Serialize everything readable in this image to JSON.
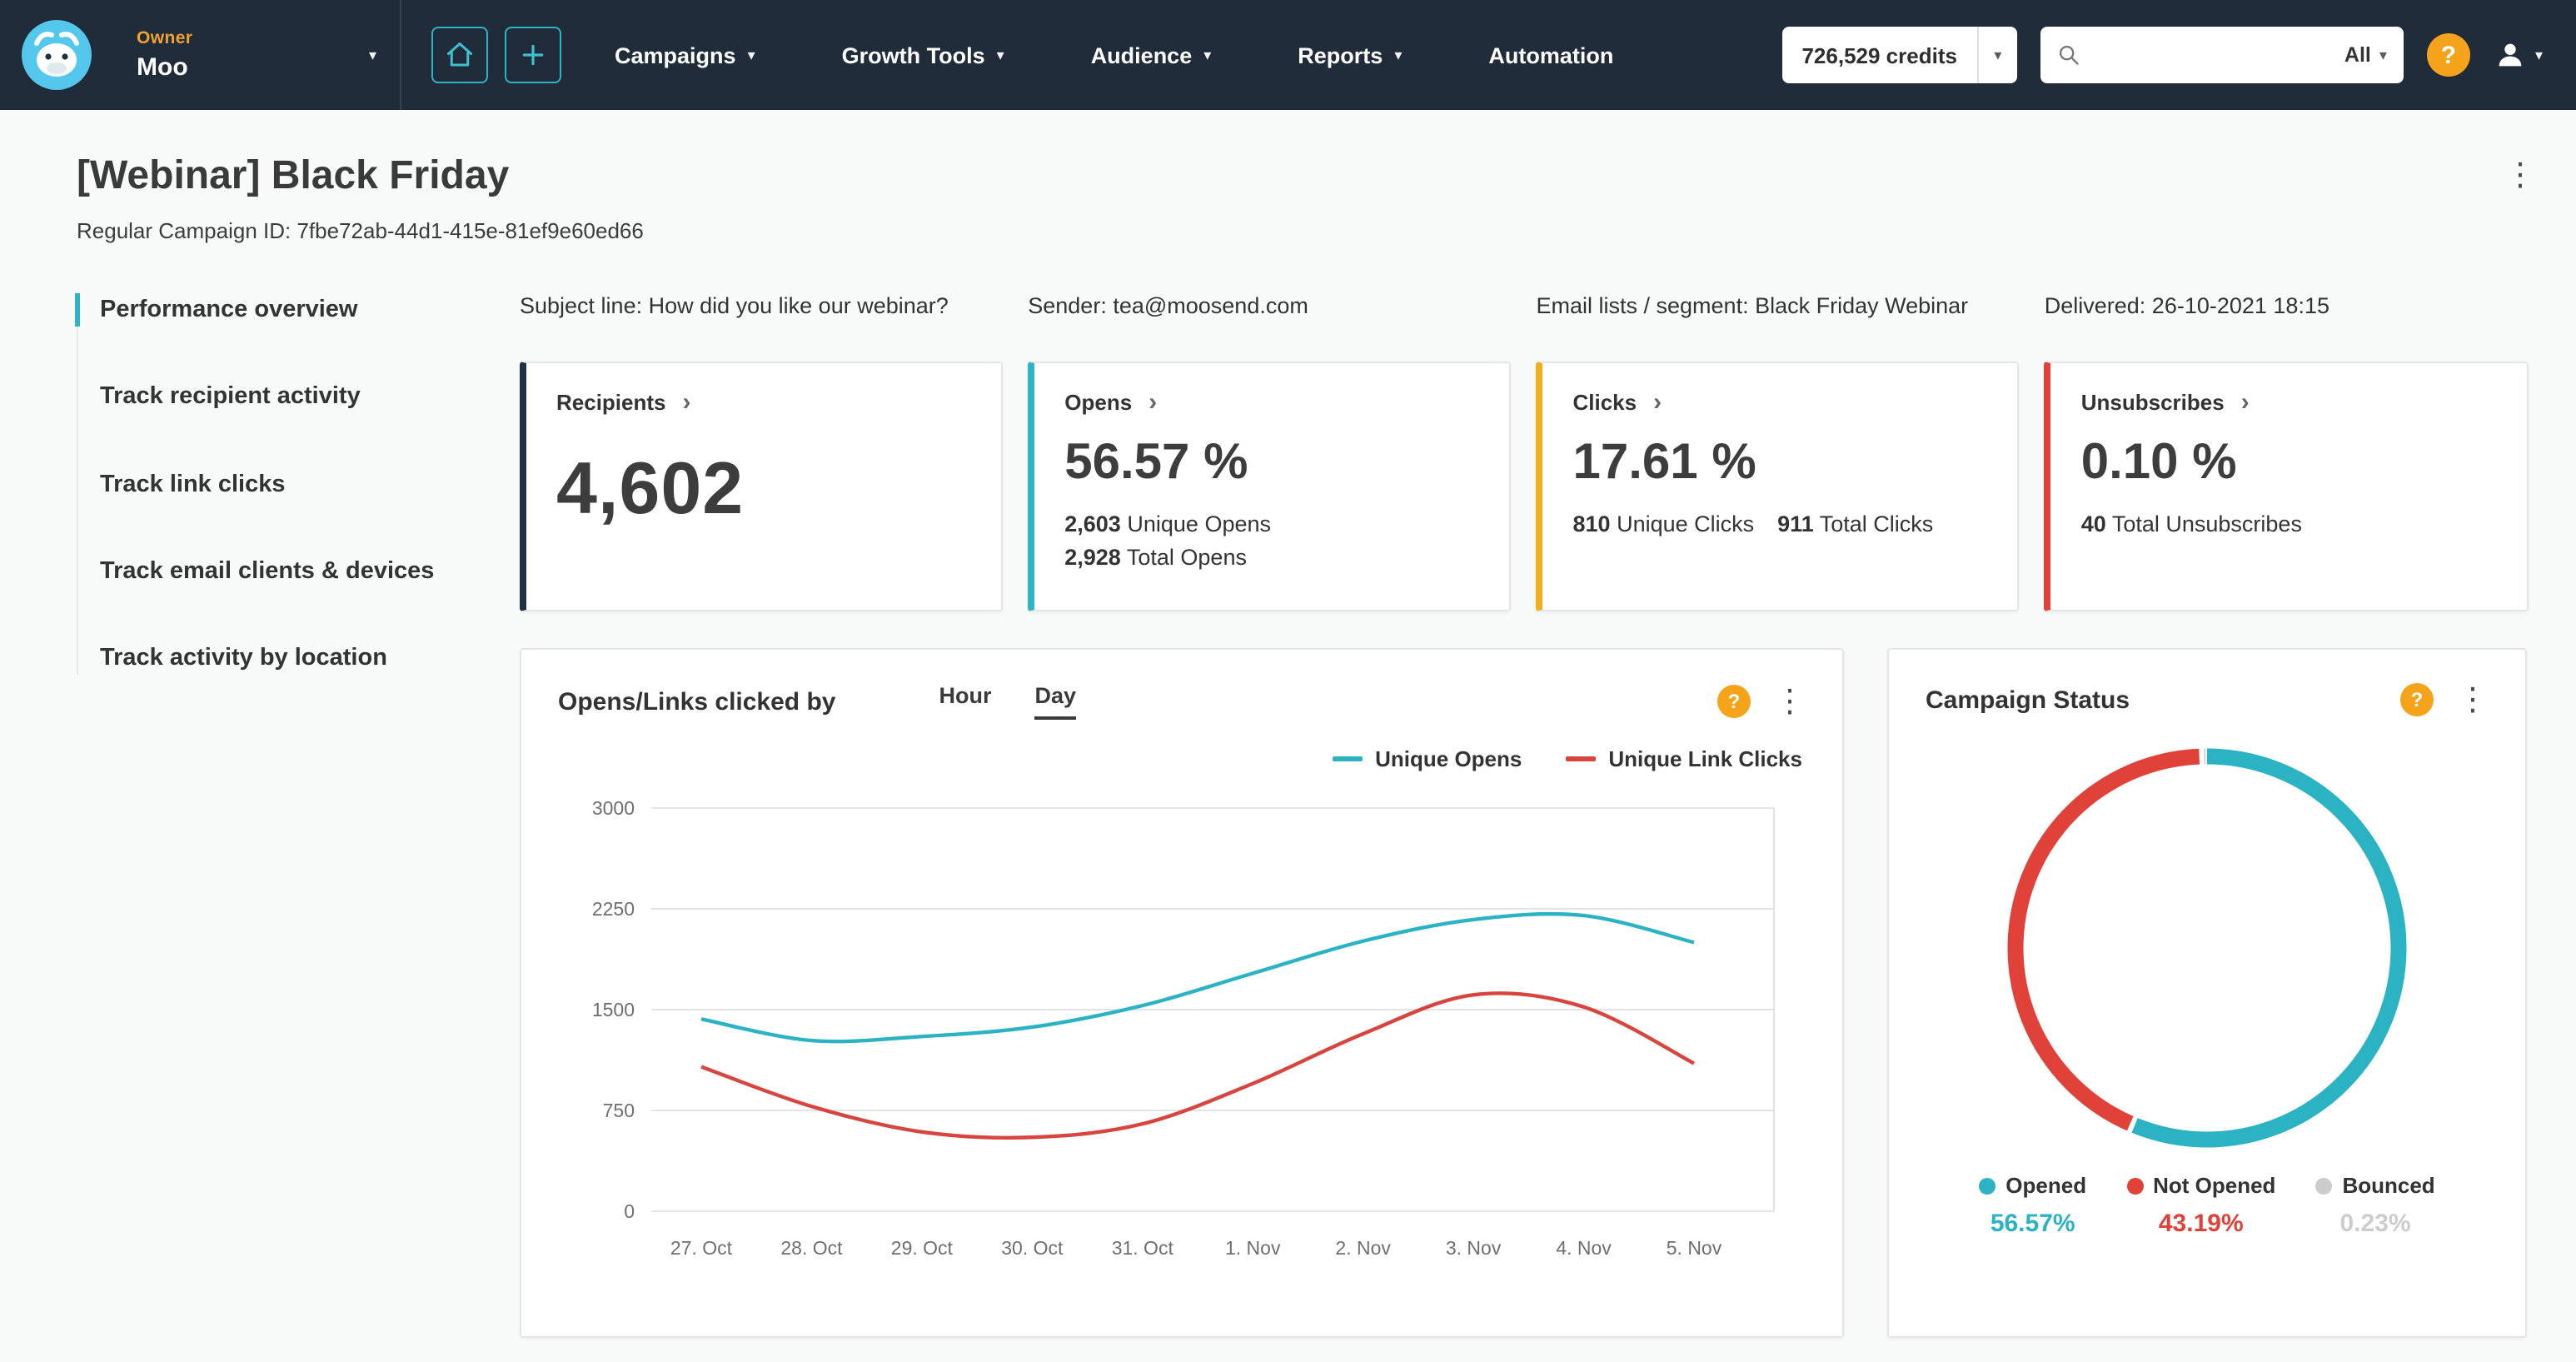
{
  "icons": {
    "kebab": "⋮",
    "caret_down": "▾",
    "chevron_right": "›",
    "help": "?"
  },
  "colors": {
    "teal": "#2db4c5",
    "red": "#e0423a",
    "amber": "#eeb021",
    "navy": "#223043",
    "orange": "#f5a31a",
    "nav_bg": "#202c3a"
  },
  "nav": {
    "owner_label": "Owner",
    "owner_name": "Moo",
    "items": [
      {
        "label": "Campaigns",
        "caret": true
      },
      {
        "label": "Growth Tools",
        "caret": true
      },
      {
        "label": "Audience",
        "caret": true
      },
      {
        "label": "Reports",
        "caret": true
      },
      {
        "label": "Automation",
        "caret": false
      }
    ],
    "credits_label": "726,529 credits",
    "search_placeholder": "",
    "search_filter": "All"
  },
  "page": {
    "title": "[Webinar] Black Friday",
    "subtitle": "Regular Campaign ID: 7fbe72ab-44d1-415e-81ef9e60ed66"
  },
  "sidebar": {
    "items": [
      {
        "label": "Performance overview"
      },
      {
        "label": "Track recipient activity"
      },
      {
        "label": "Track link clicks"
      },
      {
        "label": "Track email clients & devices"
      },
      {
        "label": "Track activity by location"
      }
    ]
  },
  "meta": {
    "subject": "Subject line: How did you like our webinar?",
    "sender": "Sender: tea@moosend.com",
    "lists": "Email lists / segment: Black Friday Webinar",
    "delivered": "Delivered: 26-10-2021 18:15"
  },
  "stats": [
    {
      "label": "Recipients",
      "value": "4,602",
      "accent": "#223043"
    },
    {
      "label": "Opens",
      "value": "56.57 %",
      "accent": "#2db4c5",
      "details": [
        {
          "num": "2,603",
          "text": "Unique Opens"
        },
        {
          "num": "2,928",
          "text": "Total Opens"
        }
      ]
    },
    {
      "label": "Clicks",
      "value": "17.61 %",
      "accent": "#eeb021",
      "details": [
        {
          "num": "810",
          "text": "Unique Clicks"
        },
        {
          "num": "911",
          "text": "Total Clicks"
        }
      ]
    },
    {
      "label": "Unsubscribes",
      "value": "0.10 %",
      "accent": "#e0423a",
      "details": [
        {
          "num": "40",
          "text": "Total Unsubscribes"
        }
      ]
    }
  ],
  "chart_data": [
    {
      "type": "line",
      "title": "Opens/Links clicked by",
      "toggle": [
        "Hour",
        "Day"
      ],
      "active_toggle": "Day",
      "x": [
        "27. Oct",
        "28. Oct",
        "29. Oct",
        "30. Oct",
        "31. Oct",
        "1. Nov",
        "2. Nov",
        "3. Nov",
        "4. Nov",
        "5. Nov"
      ],
      "series": [
        {
          "name": "Unique Opens",
          "color": "#2bb3c4",
          "values": [
            1430,
            1270,
            1300,
            1370,
            1530,
            1770,
            2010,
            2170,
            2200,
            2000
          ]
        },
        {
          "name": "Unique Link Clicks",
          "color": "#d8453e",
          "values": [
            1075,
            780,
            590,
            550,
            650,
            950,
            1320,
            1610,
            1520,
            1100
          ]
        }
      ],
      "ylim": [
        0,
        3000
      ],
      "yticks": [
        0,
        750,
        1500,
        2250,
        3000
      ],
      "grid": true,
      "legend_position": "top-right"
    },
    {
      "type": "donut",
      "title": "Campaign Status",
      "slices": [
        {
          "name": "Opened",
          "value": 56.57,
          "display": "56.57%",
          "color": "#2bb3c4"
        },
        {
          "name": "Not Opened",
          "value": 43.19,
          "display": "43.19%",
          "color": "#e0423a"
        },
        {
          "name": "Bounced",
          "value": 0.23,
          "display": "0.23%",
          "color": "#cccccc"
        }
      ]
    }
  ]
}
